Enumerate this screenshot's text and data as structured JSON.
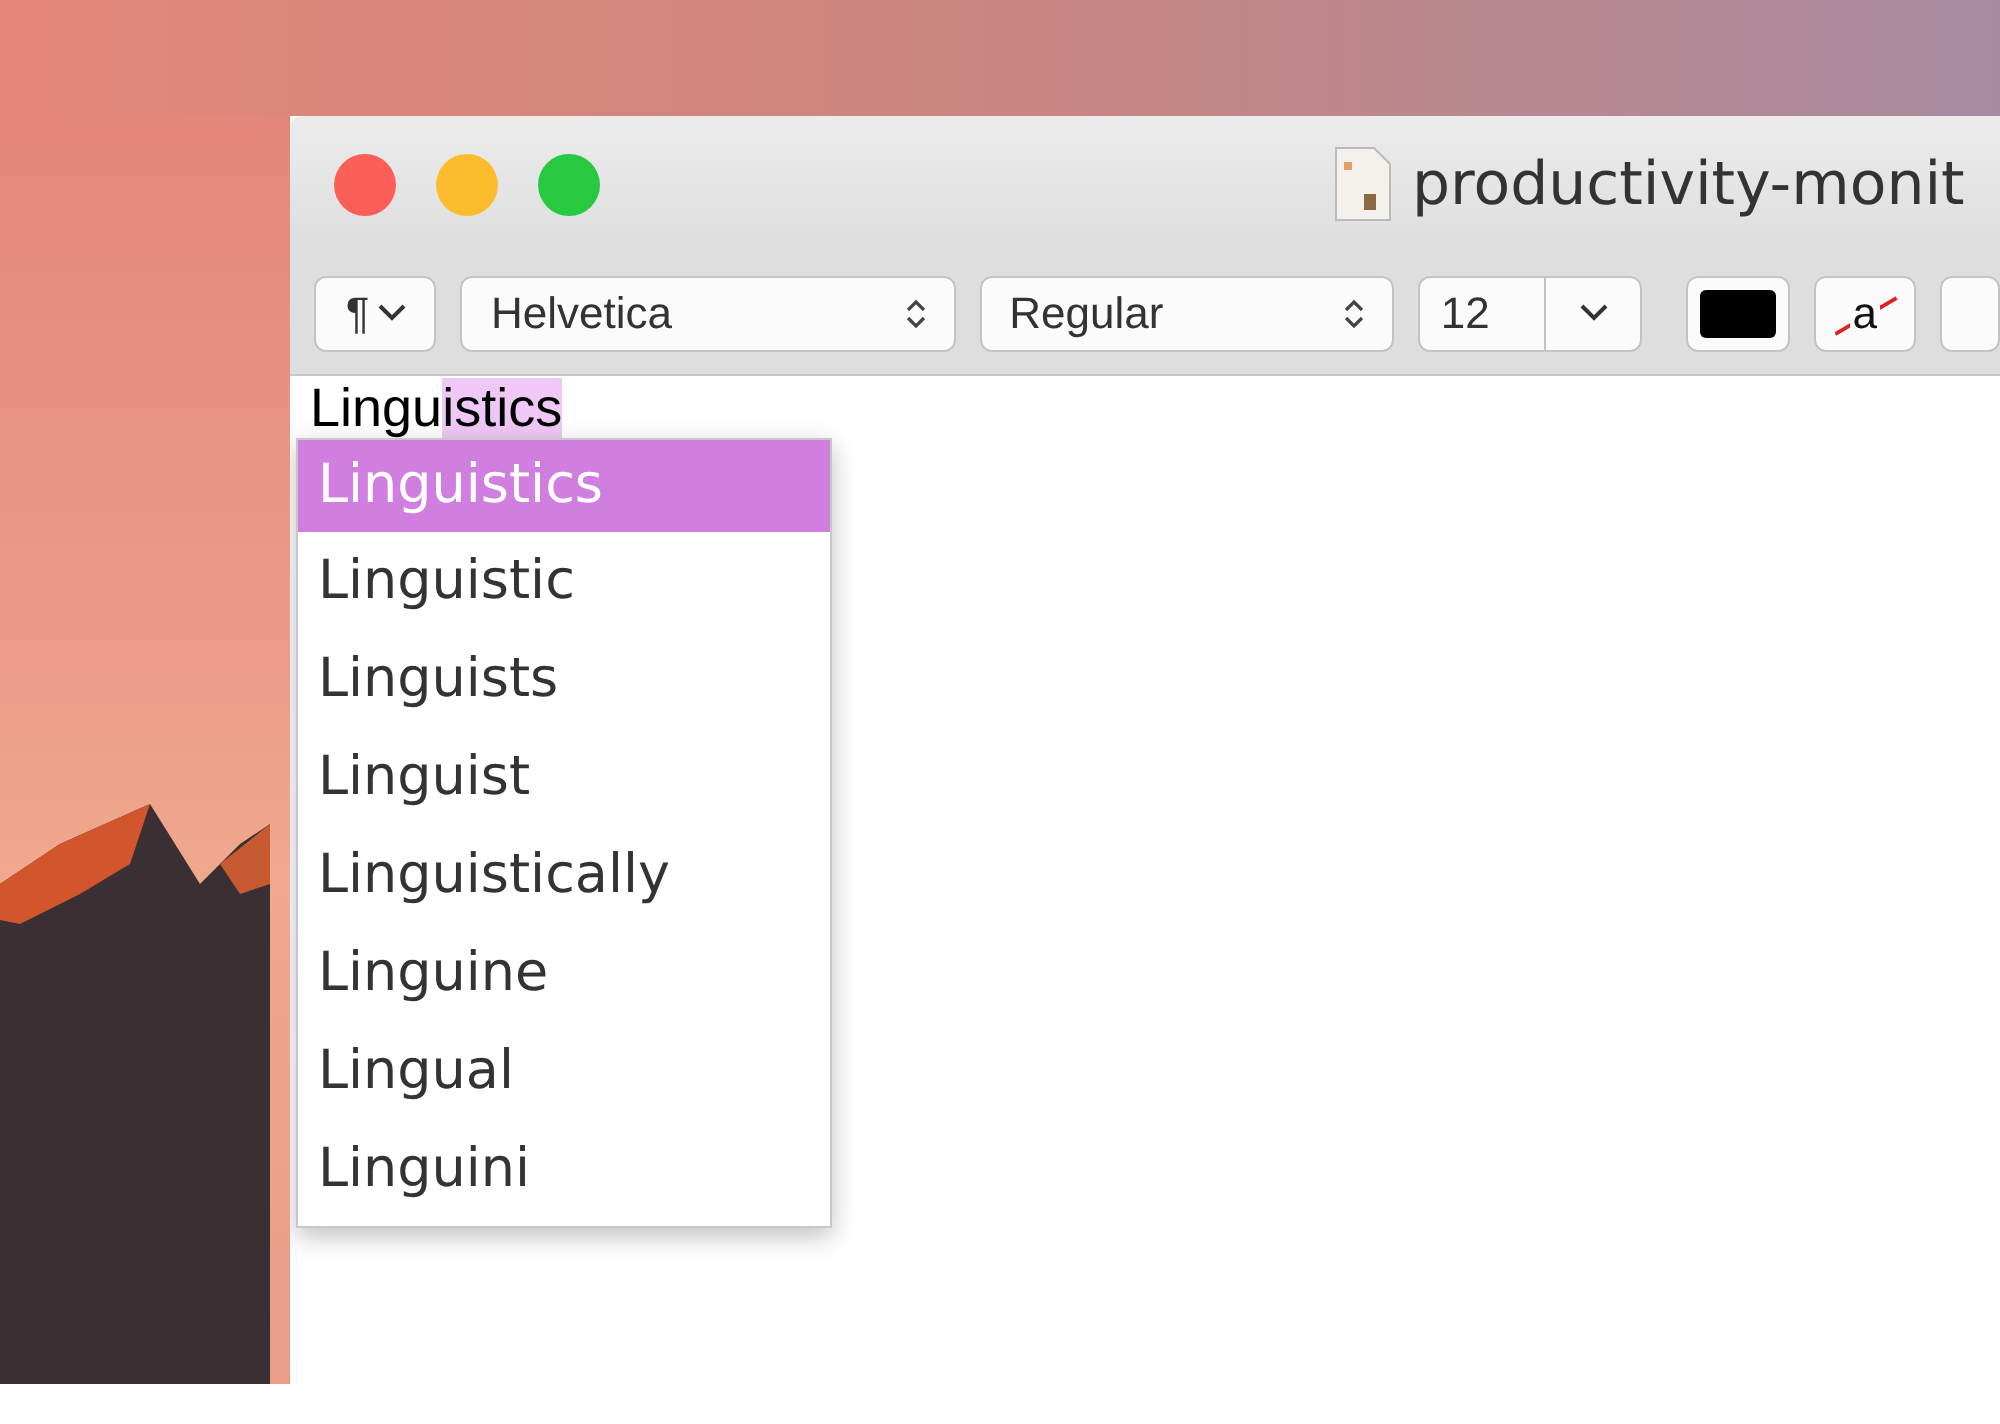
{
  "window": {
    "title": "productivity-monit"
  },
  "toolbar": {
    "paragraph_glyph": "¶",
    "font": "Helvetica",
    "style": "Regular",
    "size": "12",
    "highlight_glyph": "a"
  },
  "document": {
    "typed_text": "Lingu",
    "completion_text": "istics"
  },
  "suggestions": [
    {
      "label": "Linguistics",
      "selected": true
    },
    {
      "label": "Linguistic",
      "selected": false
    },
    {
      "label": "Linguists",
      "selected": false
    },
    {
      "label": "Linguist",
      "selected": false
    },
    {
      "label": "Linguistically",
      "selected": false
    },
    {
      "label": "Linguine",
      "selected": false
    },
    {
      "label": "Lingual",
      "selected": false
    },
    {
      "label": "Linguini",
      "selected": false
    }
  ]
}
